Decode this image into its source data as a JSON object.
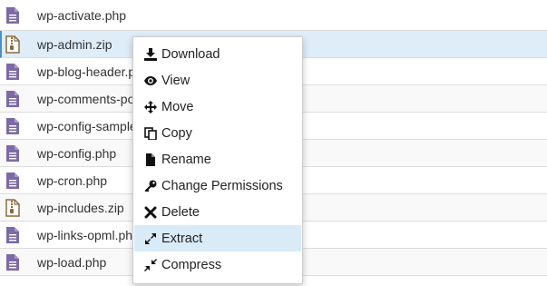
{
  "colors": {
    "file_icon_php": "#7b6aa6",
    "file_icon_zip": "#8a6a3a",
    "selected_row": "#deedf7",
    "menu_hover": "#d9ebf7"
  },
  "files": [
    {
      "name": "wp-activate.php",
      "icon": "php-file-icon"
    },
    {
      "name": "wp-admin.zip",
      "icon": "zip-file-icon"
    },
    {
      "name": "wp-blog-header.p",
      "icon": "php-file-icon"
    },
    {
      "name": "wp-comments-po",
      "icon": "php-file-icon"
    },
    {
      "name": "wp-config-sample",
      "icon": "php-file-icon"
    },
    {
      "name": "wp-config.php",
      "icon": "php-file-icon"
    },
    {
      "name": "wp-cron.php",
      "icon": "php-file-icon"
    },
    {
      "name": "wp-includes.zip",
      "icon": "zip-file-icon"
    },
    {
      "name": "wp-links-opml.ph",
      "icon": "php-file-icon"
    },
    {
      "name": "wp-load.php",
      "icon": "php-file-icon"
    }
  ],
  "context_menu": {
    "items": [
      {
        "label": "Download",
        "icon": "download-icon"
      },
      {
        "label": "View",
        "icon": "eye-icon"
      },
      {
        "label": "Move",
        "icon": "move-arrows-icon"
      },
      {
        "label": "Copy",
        "icon": "copy-icon"
      },
      {
        "label": "Rename",
        "icon": "file-icon"
      },
      {
        "label": "Change Permissions",
        "icon": "key-icon"
      },
      {
        "label": "Delete",
        "icon": "x-icon"
      },
      {
        "label": "Extract",
        "icon": "expand-icon"
      },
      {
        "label": "Compress",
        "icon": "compress-icon"
      }
    ]
  }
}
